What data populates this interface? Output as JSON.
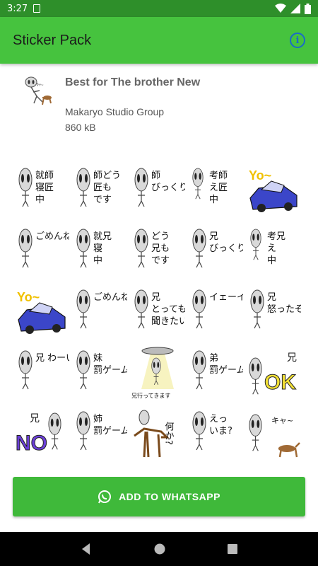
{
  "status_bar": {
    "time": "3:27"
  },
  "app_bar": {
    "title": "Sticker Pack",
    "info_glyph": "i"
  },
  "pack": {
    "name": "Best for The brother New",
    "publisher": "Makaryo Studio Group",
    "size": "860 kB"
  },
  "stickers": [
    {
      "text": "就師\n寝匠\n中",
      "kind": "alien"
    },
    {
      "text": "師どう\n匠も\nです",
      "kind": "alien"
    },
    {
      "text": "師\nびっくり!匠",
      "kind": "alien-lean"
    },
    {
      "text": "考師\nえ匠\n中",
      "kind": "alien-sit"
    },
    {
      "text": "Yo~",
      "kind": "car"
    },
    {
      "text": "ごめんね",
      "kind": "alien"
    },
    {
      "text": "就兄\n寝\n中",
      "kind": "alien"
    },
    {
      "text": "どう\n兄も\nです",
      "kind": "alien"
    },
    {
      "text": "兄\nびっくり!",
      "kind": "alien-lean"
    },
    {
      "text": "考兄\nえ\n中",
      "kind": "alien-sit"
    },
    {
      "text": "Yo~",
      "kind": "car"
    },
    {
      "text": "ごめんね",
      "kind": "alien"
    },
    {
      "text": "兄\nとっても\n聞きたい",
      "kind": "alien"
    },
    {
      "text": "イェーイ",
      "kind": "alien-wave"
    },
    {
      "text": "兄\n怒ったぞ!",
      "kind": "alien"
    },
    {
      "text": "兄 わーいわーい",
      "kind": "alien-arms"
    },
    {
      "text": "妹\n罰ゲーム",
      "kind": "alien"
    },
    {
      "text": "兄行ってきます",
      "kind": "ufo"
    },
    {
      "text": "弟\n罰ゲーム",
      "kind": "alien"
    },
    {
      "text": "兄\nOK",
      "kind": "ok"
    },
    {
      "text": "兄\nNO",
      "kind": "no"
    },
    {
      "text": "姉\n罰ゲーム",
      "kind": "alien"
    },
    {
      "text": "何か?",
      "kind": "horse"
    },
    {
      "text": "えっ\nいま?",
      "kind": "alien"
    },
    {
      "text": "キャ~",
      "kind": "dog"
    }
  ],
  "add_button": {
    "label": "ADD TO WHATSAPP"
  },
  "colors": {
    "primary": "#46c33e",
    "status": "#2e8f2a",
    "button": "#3fb93a",
    "info": "#1a6bc8"
  }
}
